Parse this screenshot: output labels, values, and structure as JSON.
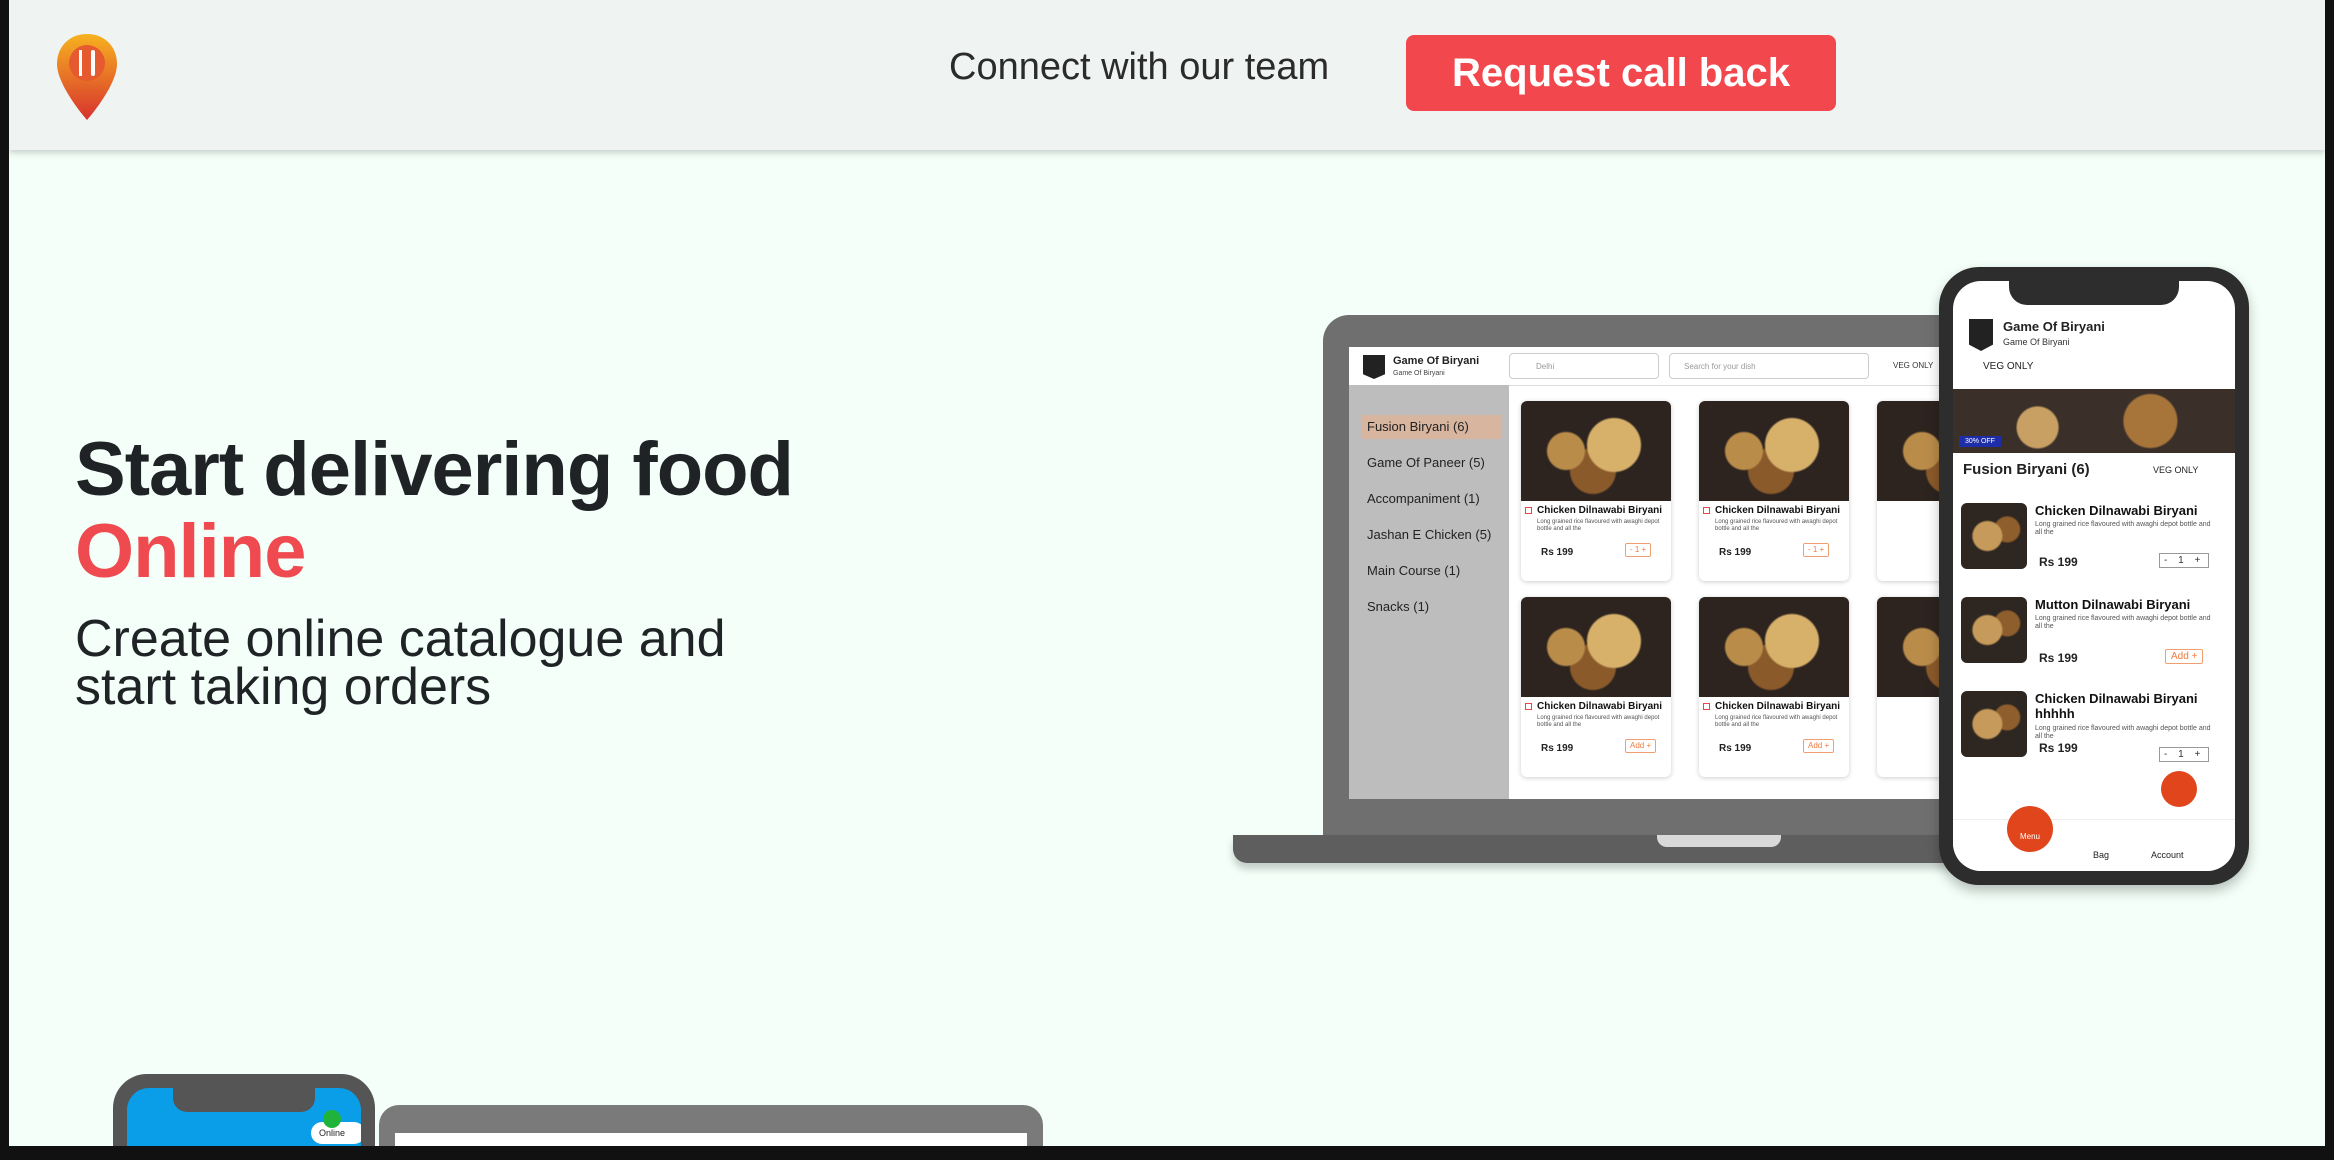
{
  "header": {
    "connect_text": "Connect with our team",
    "cta_label": "Request call back"
  },
  "hero": {
    "title": "Start delivering food",
    "title_accent": "Online",
    "subtitle": "Create online catalogue and start taking orders"
  },
  "laptop": {
    "brand": "Game Of Biryani",
    "brand_sub": "Game Of Biryani",
    "location_placeholder": "Delhi",
    "search_placeholder": "Search for your dish",
    "veg_only": "VEG ONLY",
    "categories": [
      {
        "label": "Fusion Biryani (6)"
      },
      {
        "label": "Game Of Paneer (5)"
      },
      {
        "label": "Accompaniment (1)"
      },
      {
        "label": "Jashan E Chicken (5)"
      },
      {
        "label": "Main Course  (1)"
      },
      {
        "label": "Snacks (1)"
      }
    ],
    "cards": [
      {
        "name": "Chicken Dilnawabi Biryani",
        "desc": "Long grained rice flavoured with awaghi depot bottle and all the",
        "price": "Rs 199",
        "action": "- 1 +"
      },
      {
        "name": "Chicken Dilnawabi Biryani",
        "desc": "Long grained rice flavoured with awaghi depot bottle and all the",
        "price": "Rs 199",
        "action": "- 1 +"
      },
      {
        "name": "Chicken Dilnawabi Biryani",
        "desc": "Long grained rice flavoured with awaghi depot bottle and all the",
        "price": "Rs 199",
        "action": "Add +"
      },
      {
        "name": "Chicken Dilnawabi Biryani",
        "desc": "Long grained rice flavoured with awaghi depot bottle and all the",
        "price": "Rs 199",
        "action": "Add +"
      }
    ]
  },
  "phone": {
    "brand": "Game Of Biryani",
    "brand_sub": "Game Of Biryani",
    "veg_only": "VEG ONLY",
    "offer": "30% OFF",
    "section": "Fusion Biryani (6)",
    "items": [
      {
        "name": "Chicken Dilnawabi Biryani",
        "desc": "Long grained rice flavoured with awaghi depot bottle and all the",
        "price": "Rs 199",
        "action": "- 1 +"
      },
      {
        "name": "Mutton Dilnawabi Biryani",
        "desc": "Long grained rice flavoured with awaghi depot bottle and all the",
        "price": "Rs 199",
        "action": "Add +"
      },
      {
        "name": "Chicken Dilnawabi Biryani hhhhh",
        "desc": "Long grained rice flavoured with awaghi depot bottle and all the",
        "price": "Rs 199",
        "action": "- 1 +"
      }
    ],
    "nav": {
      "menu": "Menu",
      "bag": "Bag",
      "account": "Account"
    }
  },
  "bottom_phone": {
    "status": "Online"
  },
  "colors": {
    "accent": "#f2474d",
    "hero_background": "#f3fff8",
    "header_background": "#eff3f2"
  }
}
